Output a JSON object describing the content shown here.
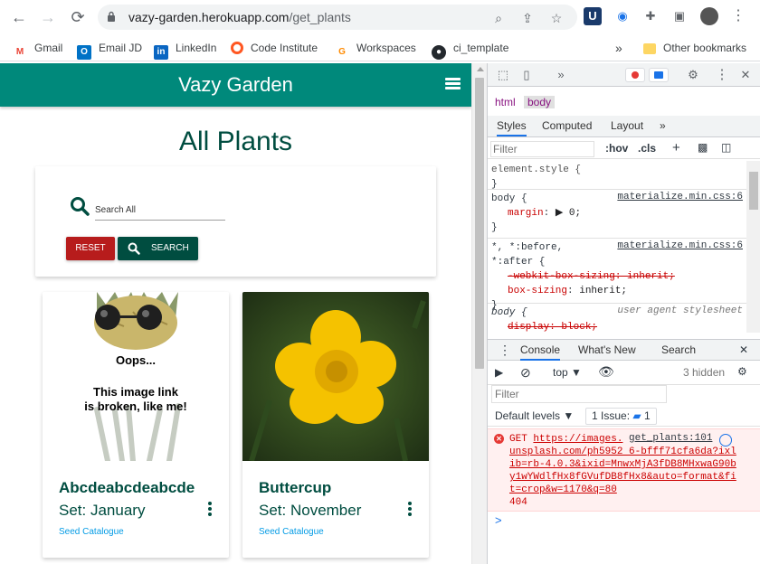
{
  "browser": {
    "url_host": "vazy-garden.herokuapp.com",
    "url_path": "/get_plants",
    "bookmarks": [
      {
        "label": "Gmail",
        "icon": "gmail-icon"
      },
      {
        "label": "Email JD",
        "icon": "outlook-icon"
      },
      {
        "label": "LinkedIn",
        "icon": "linkedin-icon"
      },
      {
        "label": "Code Institute",
        "icon": "code-institute-icon"
      },
      {
        "label": "Workspaces",
        "icon": "gitpod-icon"
      },
      {
        "label": "ci_template",
        "icon": "github-icon"
      }
    ],
    "overflow": "»",
    "other_bookmarks": "Other bookmarks"
  },
  "app": {
    "brand": "Vazy Garden",
    "page_title": "All Plants",
    "search": {
      "placeholder": "Search All",
      "reset_label": "RESET",
      "search_label": "SEARCH"
    },
    "cards": [
      {
        "name": "Abcdeabcdeabcde",
        "set": "Set: January",
        "link": "Seed Catalogue",
        "oops_title": "Oops...",
        "oops_line1": "This image link",
        "oops_line2": "is broken, like me!"
      },
      {
        "name": "Buttercup",
        "set": "Set: November",
        "link": "Seed Catalogue"
      }
    ],
    "colors": {
      "primary": "#00897b",
      "dark": "#004d40",
      "reset": "#b71c1c"
    }
  },
  "devtools": {
    "breadcrumbs": [
      "html",
      "body"
    ],
    "tabs": [
      "Styles",
      "Computed",
      "Layout"
    ],
    "tabs_more": "»",
    "filter_placeholder": "Filter",
    "hov": ":hov",
    "cls": ".cls",
    "rules": [
      {
        "selector": "element.style {",
        "close": "}"
      },
      {
        "selector": "body {",
        "source": "materialize.min.css:6",
        "prop": "margin",
        "value": "▶ 0;",
        "close": "}"
      },
      {
        "selector": "*, *:before,",
        "selector2": "*:after {",
        "source": "materialize.min.css:6",
        "prop_struck": "-webkit-box-sizing: inherit;",
        "prop": "box-sizing",
        "value": "inherit;",
        "close": "}"
      },
      {
        "selector": "body {",
        "source": "user agent stylesheet",
        "prop": "display: block;"
      }
    ],
    "console_tabs": [
      "Console",
      "What's New",
      "Search"
    ],
    "context": "top",
    "hidden": "3 hidden",
    "console_filter": "Filter",
    "default_levels": "Default levels ▼",
    "issue": "1 Issue:",
    "issue_count": "1",
    "error": {
      "method": "GET",
      "url_part1": "https://images.",
      "url_rest": "unsplash.com/ph5952 6-bfff71cfa6da?ixlib=rb-4.0.3&ixid=MnwxMjA3fDB8MHxwaG90by1wYWdlfHx8fGVufDB8fHx8&auto=format&fit=crop&w=1170&q=80",
      "status": "404",
      "source": "get_plants:101"
    },
    "prompt": ">"
  }
}
